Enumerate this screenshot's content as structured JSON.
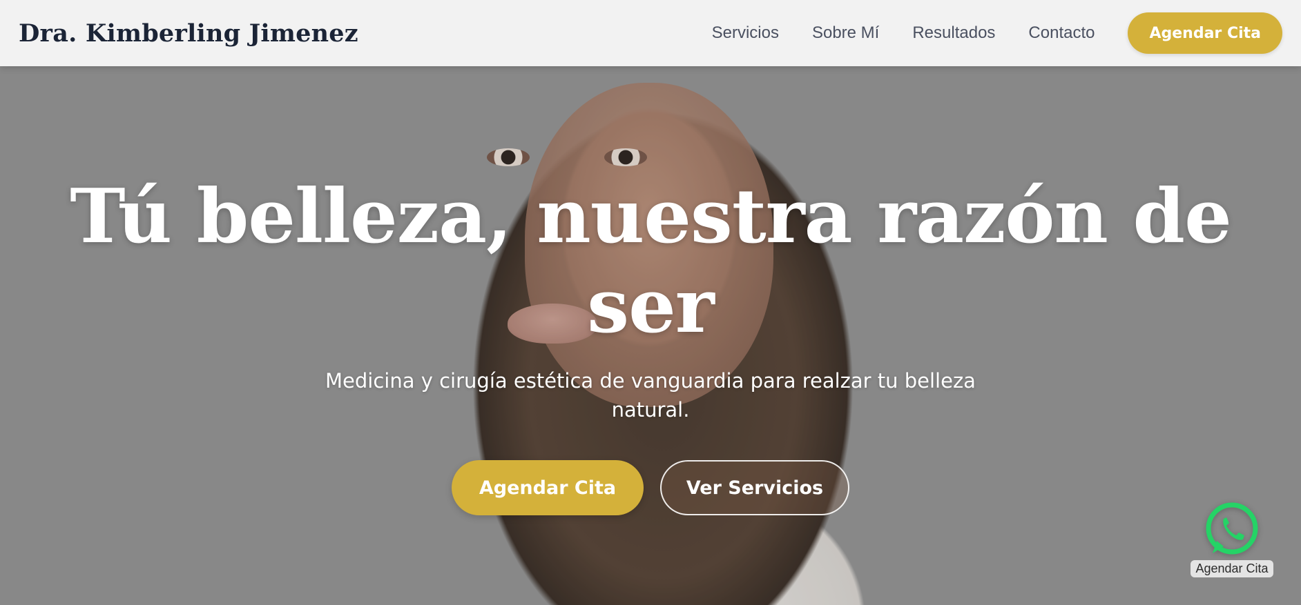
{
  "header": {
    "brand": "Dra. Kimberling Jimenez",
    "nav": [
      {
        "label": "Servicios"
      },
      {
        "label": "Sobre Mí"
      },
      {
        "label": "Resultados"
      },
      {
        "label": "Contacto"
      }
    ],
    "cta_label": "Agendar Cita"
  },
  "hero": {
    "title": "Tú belleza, nuestra razón de ser",
    "subtitle": "Medicina y cirugía estética de vanguardia para realzar tu belleza natural.",
    "primary_button": "Agendar Cita",
    "secondary_button": "Ver Servicios",
    "background_image": "portrait-photo"
  },
  "whatsapp": {
    "icon": "whatsapp-icon",
    "label": "Agendar Cita"
  },
  "colors": {
    "accent": "#d4b13a",
    "brand_text": "#1b2436",
    "nav_text": "#4a5060",
    "whatsapp_green": "#25d366"
  }
}
